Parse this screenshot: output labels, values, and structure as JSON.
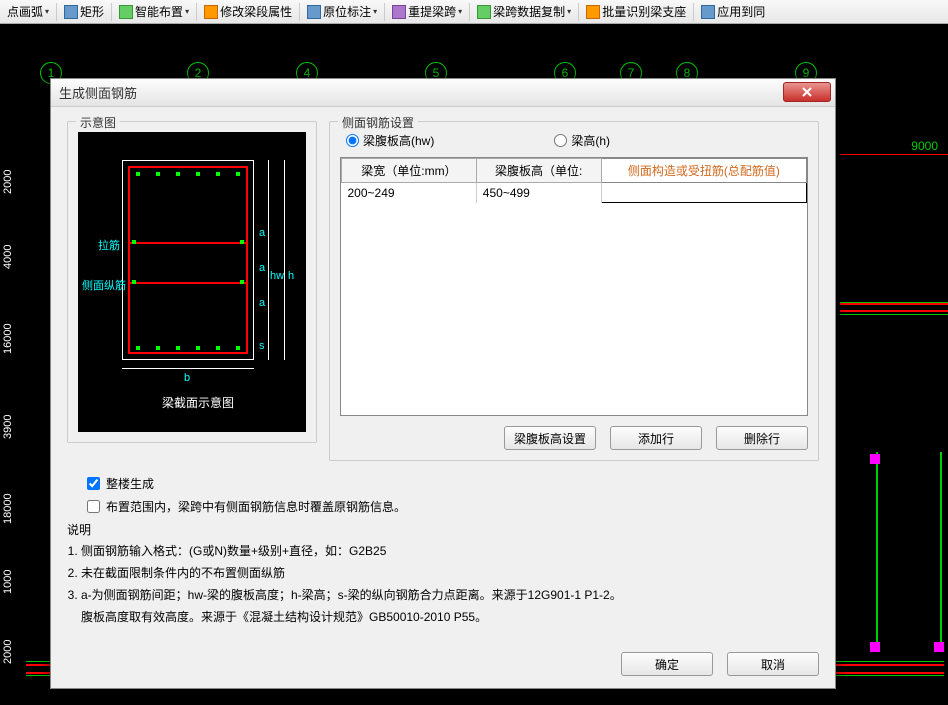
{
  "toolbar": {
    "items": [
      {
        "label": "点画弧"
      },
      {
        "label": "矩形"
      },
      {
        "label": "智能布置"
      },
      {
        "label": "修改梁段属性"
      },
      {
        "label": "原位标注"
      },
      {
        "label": "重提梁跨"
      },
      {
        "label": "梁跨数据复制"
      },
      {
        "label": "批量识别梁支座"
      },
      {
        "label": "应用到同"
      }
    ]
  },
  "canvas": {
    "grid_numbers": [
      "1",
      "2",
      "4",
      "5",
      "6",
      "7",
      "8",
      "9"
    ],
    "dim_right": "9000",
    "ruler_vals": [
      "2000",
      "4000",
      "16000",
      "3900",
      "18000",
      "1000",
      "2000"
    ]
  },
  "dialog": {
    "title": "生成侧面钢筋",
    "schematic_label": "示意图",
    "schematic_caption": "梁截面示意图",
    "schematic_annot": {
      "lajin": "拉筋",
      "cemian": "侧面纵筋",
      "hw": "hw",
      "h": "h",
      "a": "a",
      "s": "s",
      "b": "b"
    },
    "settings_label": "侧面钢筋设置",
    "radio_hw": "梁腹板高(hw)",
    "radio_h": "梁高(h)",
    "table": {
      "headers": [
        "梁宽（单位:mm）",
        "梁腹板高（单位:",
        "侧面构造或受扭筋(总配筋值)"
      ],
      "rows": [
        {
          "w": "200~249",
          "h": "450~499",
          "v": ""
        }
      ]
    },
    "btn_hw_setting": "梁腹板高设置",
    "btn_add_row": "添加行",
    "btn_del_row": "删除行",
    "check_whole": "整楼生成",
    "check_override": "布置范围内，梁跨中有侧面钢筋信息时覆盖原钢筋信息。",
    "desc_label": "说明",
    "desc1": "侧面钢筋输入格式：(G或N)数量+级别+直径，如：G2B25",
    "desc2": "未在截面限制条件内的不布置侧面纵筋",
    "desc3": "a-为侧面钢筋间距；hw-梁的腹板高度；h-梁高；s-梁的纵向钢筋合力点距离。来源于12G901-1 P1-2。",
    "desc3b": "腹板高度取有效高度。来源于《混凝土结构设计规范》GB50010-2010 P55。",
    "btn_ok": "确定",
    "btn_cancel": "取消"
  }
}
